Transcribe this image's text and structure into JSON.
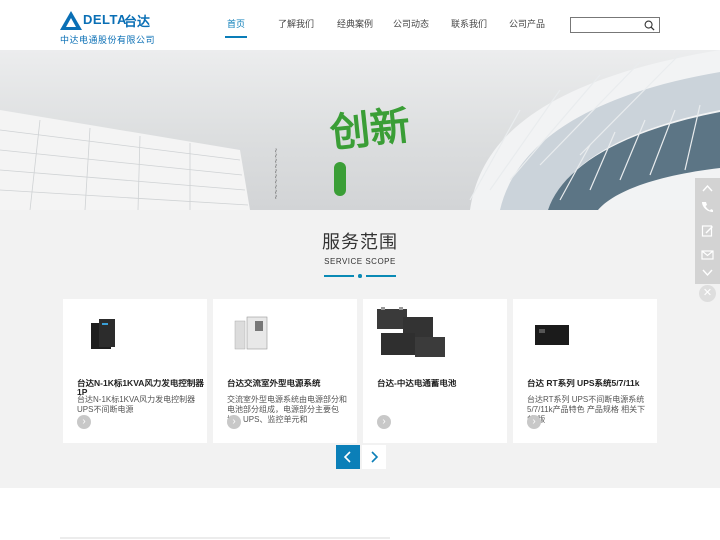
{
  "brand": {
    "logo_text": "DELTA",
    "logo_text_cn": "台达",
    "company_name": "中达电通股份有限公司",
    "brand_color": "#0a6fb5"
  },
  "nav": {
    "items": [
      {
        "label": "首页",
        "active": true
      },
      {
        "label": "了解我们",
        "active": false
      },
      {
        "label": "经典案例",
        "active": false
      },
      {
        "label": "公司动态",
        "active": false
      },
      {
        "label": "联系我们",
        "active": false
      },
      {
        "label": "公司产品",
        "active": false
      }
    ],
    "active_color": "#0a7db8"
  },
  "search": {
    "placeholder": "",
    "icon": "search-icon"
  },
  "banner": {
    "headline": "创新",
    "accent_color": "#3a9e36"
  },
  "services": {
    "title": "服务范围",
    "subtitle": "SERVICE SCOPE",
    "cards": [
      {
        "title": "台达N-1K标1KVA风力发电控制器1P",
        "desc": "台达N-1K标1KVA风力发电控制器UPS不间断电源",
        "more_icon": "chevron-right-icon"
      },
      {
        "title": "台达交流室外型电源系统",
        "desc": "交流室外型电源系统由电源部分和电池部分组成，电源部分主要包括：UPS、监控单元和",
        "more_icon": "chevron-right-icon"
      },
      {
        "title": "台达-中达电通蓄电池",
        "desc": "",
        "more_icon": "chevron-right-icon"
      },
      {
        "title": "台达 RT系列 UPS系统5/7/11k",
        "desc": "台达RT系列 UPS不间断电源系统5/7/11k产品特色 产品规格 相关下载 版",
        "more_icon": "chevron-right-icon"
      }
    ],
    "prev_icon": "chevron-left-icon",
    "next_icon": "chevron-right-icon"
  },
  "float_bar": {
    "icons": [
      "chevron-up-icon",
      "phone-icon",
      "edit-icon",
      "mail-icon",
      "chevron-down-icon"
    ],
    "close_icon": "close-icon"
  }
}
